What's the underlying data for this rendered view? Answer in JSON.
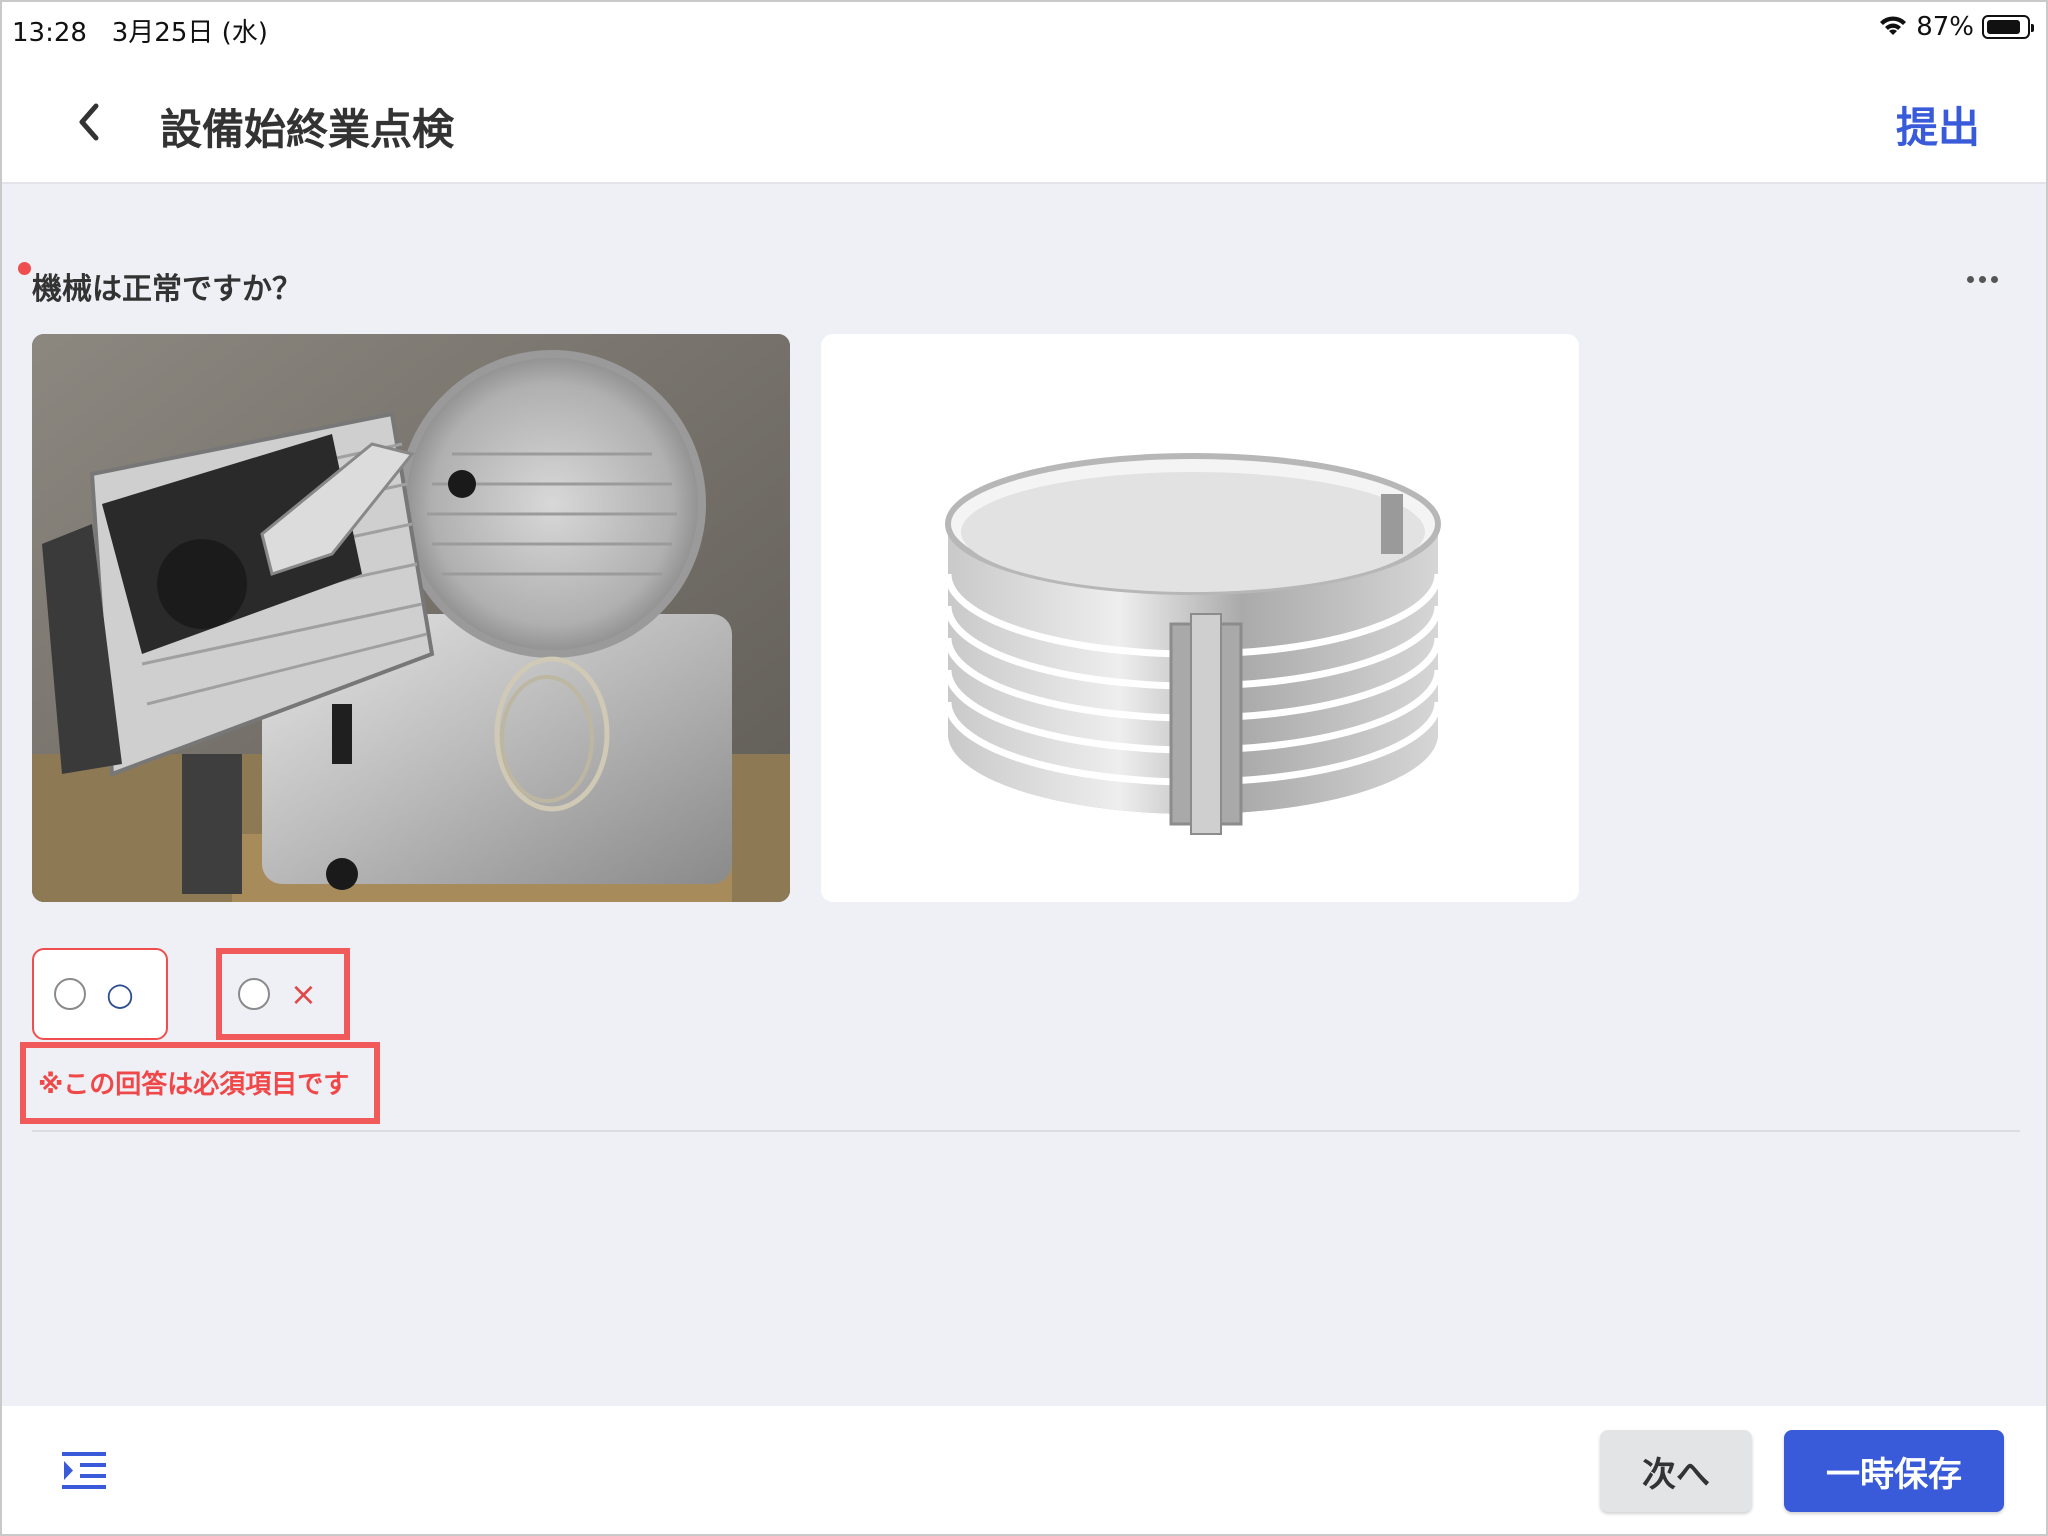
{
  "status_bar": {
    "time": "13:28",
    "date": "3月25日 (水)",
    "battery_percent": "87%",
    "battery_level": 0.87
  },
  "header": {
    "title": "設備始終業点検",
    "submit_label": "提出",
    "back_icon": "chevron-left-icon"
  },
  "question": {
    "text": "機械は正常ですか？",
    "required": true,
    "images": [
      {
        "subject": "meat slicer"
      },
      {
        "subject": "adjustable cake ring"
      }
    ],
    "options": [
      {
        "label": "○",
        "selected": false
      },
      {
        "label": "×",
        "selected": false
      }
    ],
    "error_message": "※この回答は必須項目です"
  },
  "footer": {
    "next_label": "次へ",
    "save_label": "一時保存",
    "list_icon": "list-indent-icon"
  },
  "colors": {
    "accent": "#3a5bd9",
    "error": "#f04e4e",
    "background": "#eef0f5"
  }
}
